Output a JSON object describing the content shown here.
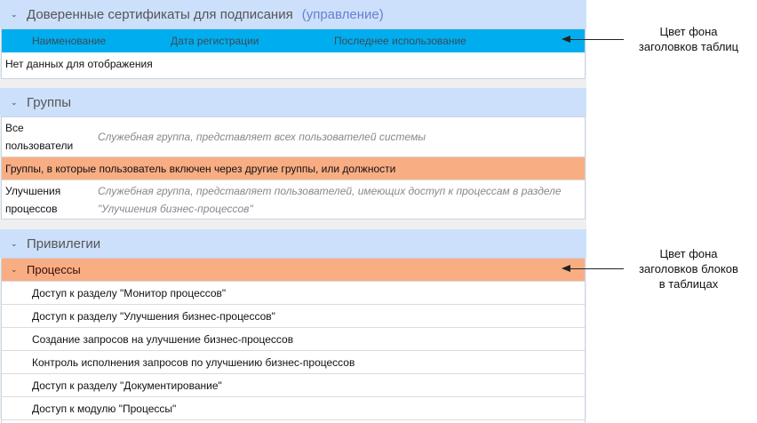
{
  "certificates": {
    "title": "Доверенные сертификаты для подписания",
    "manage_link": "(управление)",
    "columns": [
      "Наименование",
      "Дата регистрации",
      "Последнее использование"
    ],
    "empty": "Нет данных для отображения"
  },
  "groups": {
    "title": "Группы",
    "rows": [
      {
        "name": "Все пользователи",
        "name_lines": [
          "Все",
          "пользователи"
        ],
        "desc": "Служебная группа, представляет всех пользователей системы"
      },
      {
        "block": "Группы, в которые пользователь включен через другие группы, или должности"
      },
      {
        "name_lines": [
          "Улучшения",
          "процессов"
        ],
        "desc_lines": [
          "Служебная группа, представляет пользователей, имеющих доступ к процессам в разделе",
          "\"Улучшения бизнес-процессов\""
        ]
      }
    ]
  },
  "privileges": {
    "title": "Привилегии",
    "block": "Процессы",
    "items": [
      "Доступ к разделу \"Монитор процессов\"",
      "Доступ к разделу \"Улучшения бизнес-процессов\"",
      "Создание запросов на улучшение бизнес-процессов",
      "Контроль исполнения запросов по улучшению бизнес-процессов",
      "Доступ к разделу \"Документирование\"",
      "Доступ к модулю \"Процессы\""
    ]
  },
  "annotations": {
    "table_header": [
      "Цвет фона",
      "заголовков таблиц"
    ],
    "block_header": [
      "Цвет фона",
      "заголовков блоков",
      "в таблицах"
    ]
  },
  "colors": {
    "table_header": "#00aeef",
    "block_header": "#f9ad83",
    "section_header": "#cce0fb"
  }
}
